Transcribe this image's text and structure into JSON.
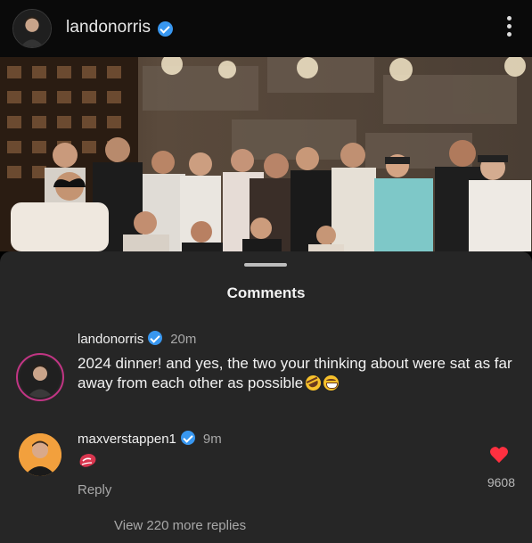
{
  "post": {
    "username": "landonorris",
    "verified": true,
    "avatar_icon": "profile-photo",
    "more_icon": "more-vertical-icon"
  },
  "photo": {
    "description_icon": "group-dinner-photo"
  },
  "comments_sheet": {
    "title": "Comments",
    "comments": [
      {
        "username": "landonorris",
        "verified": true,
        "time": "20m",
        "text": "2024 dinner! and yes, the two your thinking about were sat as far away from each other as possible",
        "emojis": [
          "rolling-on-floor-laughing-emoji",
          "grinning-emoji"
        ]
      },
      {
        "username": "maxverstappen1",
        "verified": true,
        "time": "9m",
        "emoji": "meat-emoji",
        "reply_label": "Reply",
        "likes": "9608",
        "like_color": "#ff3040"
      }
    ],
    "view_replies": "View 220 more replies"
  },
  "colors": {
    "background": "#262626",
    "header": "#0a0a0a",
    "verified_badge": "#3897f0",
    "muted_text": "#a8a8a8"
  }
}
